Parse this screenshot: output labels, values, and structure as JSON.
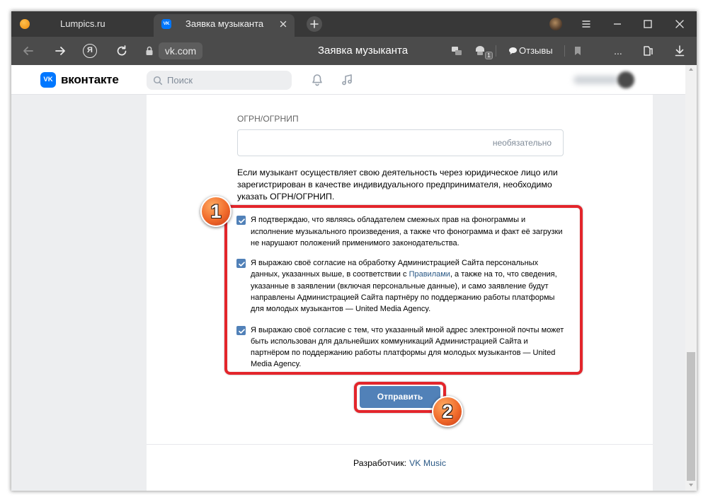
{
  "browser": {
    "tabs": [
      {
        "label": "Lumpics.ru",
        "icon": "lumpics-favicon-icon",
        "active": false
      },
      {
        "label": "Заявка музыканта",
        "icon": "vk-favicon-icon",
        "active": true,
        "favicon_mark": "VK"
      }
    ],
    "toolbar": {
      "yandex_letter": "Я",
      "address": "vk.com",
      "page_title": "Заявка музыканта",
      "extension_badge": "1",
      "reviews_label": "Отзывы",
      "more_label": "..."
    },
    "toolbar_icons": [
      "back-icon",
      "forward-icon",
      "yandex-icon",
      "reload-icon",
      "lock-icon",
      "page-action-icon",
      "extension-icon",
      "reviews-bubble-icon",
      "bookmark-icon",
      "collections-icon",
      "download-icon"
    ],
    "window_controls": [
      "account-icon",
      "menu-icon",
      "minimize-icon",
      "maximize-icon",
      "close-icon"
    ]
  },
  "vk_header": {
    "logo_mark": "VK",
    "logo_text": "вконтакте",
    "search_placeholder": "Поиск",
    "icons": [
      "search-icon",
      "notifications-bell-icon",
      "music-note-icon"
    ]
  },
  "form": {
    "ogrn": {
      "label": "ОГРН/ОГРНИП",
      "placeholder": "необязательно",
      "value": ""
    },
    "hint_lines": [
      "Если музыкант осуществляет свою деятельность через юридическое лицо или",
      "зарегистрирован в качестве индивидуального предпринимателя, необходимо",
      "указать ОГРН/ОГРНИП."
    ],
    "consents": [
      {
        "checked": true,
        "lines": [
          "Я подтверждаю, что являясь обладателем смежных прав на фонограммы и",
          "исполнение музыкального произведения, а также что фонограмма и факт её загрузки",
          "не нарушают положений применимого законодательства."
        ]
      },
      {
        "checked": true,
        "lines": [
          "Я выражаю своё согласие на обработку Администрацией Сайта персональных",
          {
            "before": "данных, указанных выше, в соответствии с ",
            "link": "Правилами",
            "after": ", а также на то, что сведения,"
          },
          "указанные в заявлении (включая персональные данные), и само заявление будут",
          "направлены Администрацией Сайта партнёру по поддержанию работы платформы",
          "для молодых музыкантов — United Media Agency."
        ]
      },
      {
        "checked": true,
        "lines": [
          "Я выражаю своё согласие с тем, что указанный мной адрес электронной почты может",
          "быть использован для дальнейших коммуникаций Администрацией Сайта и",
          "партнёром по поддержанию работы платформы для молодых музыкантов — United",
          "Media Agency."
        ]
      }
    ],
    "submit_label": "Отправить"
  },
  "footer": {
    "developer_label": "Разработчик:",
    "developer_link": "VK Music"
  },
  "annotations": [
    {
      "number": "1"
    },
    {
      "number": "2"
    }
  ],
  "colors": {
    "vk_blue": "#0077ff",
    "button_blue": "#5181b8",
    "link_blue": "#2a5885",
    "annotation_red": "#e3252b",
    "page_bg": "#edeef0",
    "chrome_dark": "#383838",
    "chrome_mid": "#4b4b4b"
  }
}
